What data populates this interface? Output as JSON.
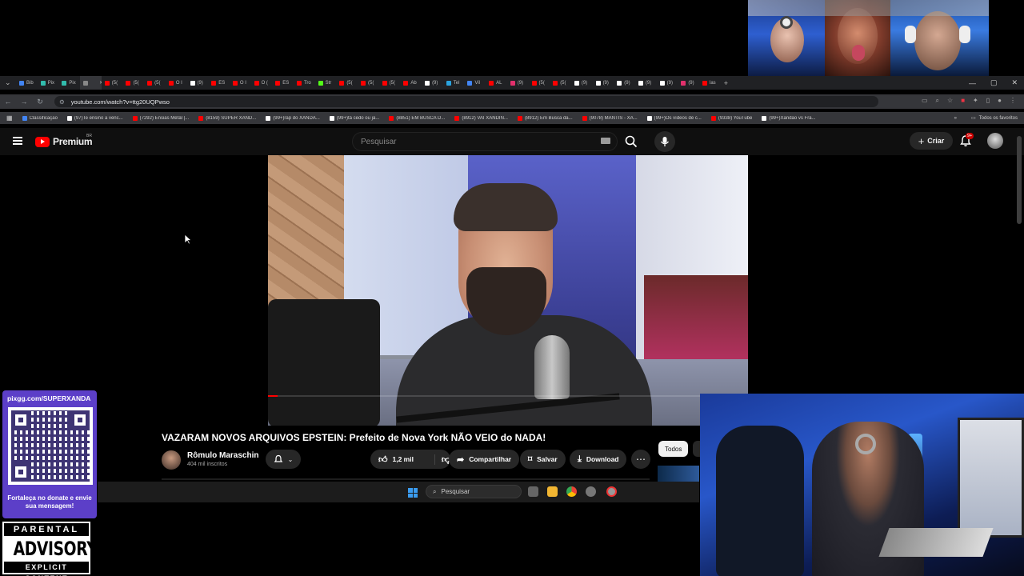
{
  "browser": {
    "url": "youtube.com/watch?v=ttg20UQPwso",
    "tabs": [
      {
        "label": "Bib",
        "color": "#4285f4"
      },
      {
        "label": "Pix",
        "color": "#32bcad"
      },
      {
        "label": "Pix",
        "color": "#32bcad"
      },
      {
        "label": "",
        "color": "#888888"
      },
      {
        "label": "(5(",
        "color": "#ff0000"
      },
      {
        "label": "(5(",
        "color": "#ff0000"
      },
      {
        "label": "(5(",
        "color": "#ff0000"
      },
      {
        "label": "O I",
        "color": "#ff0000"
      },
      {
        "label": "(9)",
        "color": "#ffffff"
      },
      {
        "label": "ES",
        "color": "#ff0000"
      },
      {
        "label": "O I",
        "color": "#ff0000"
      },
      {
        "label": "O (",
        "color": "#ff0000"
      },
      {
        "label": "ES",
        "color": "#ff0000"
      },
      {
        "label": "Tro",
        "color": "#ff0000"
      },
      {
        "label": "Str",
        "color": "#53fc18"
      },
      {
        "label": "(5(",
        "color": "#ff0000"
      },
      {
        "label": "(5(",
        "color": "#ff0000"
      },
      {
        "label": "(5(",
        "color": "#ff0000"
      },
      {
        "label": "Ab",
        "color": "#ff0000"
      },
      {
        "label": "(9)",
        "color": "#ffffff"
      },
      {
        "label": "Tel",
        "color": "#2aa3df"
      },
      {
        "label": "Vil",
        "color": "#4285f4"
      },
      {
        "label": "AL",
        "color": "#ff0000"
      },
      {
        "label": "(9)",
        "color": "#e1306c"
      },
      {
        "label": "(5(",
        "color": "#ff0000"
      },
      {
        "label": "(5(",
        "color": "#ff0000"
      },
      {
        "label": "(9)",
        "color": "#ffffff"
      },
      {
        "label": "(9)",
        "color": "#ffffff"
      },
      {
        "label": "(9)",
        "color": "#ffffff"
      },
      {
        "label": "(9)",
        "color": "#ffffff"
      },
      {
        "label": "(9)",
        "color": "#ffffff"
      },
      {
        "label": "(9)",
        "color": "#e1306c"
      },
      {
        "label": "las",
        "color": "#ff0000"
      }
    ],
    "bookmarks": [
      {
        "label": "Classificação",
        "color": "#4285f4"
      },
      {
        "label": "(97)Te ensino a venc...",
        "color": "#ffffff"
      },
      {
        "label": "(7292) Ensias Metal |...",
        "color": "#ff0000"
      },
      {
        "label": "(8159) SUPER XAND...",
        "color": "#ff0000"
      },
      {
        "label": "(99+)rap do XANDÃ...",
        "color": "#ffffff"
      },
      {
        "label": "(99+)tá cedo ou já...",
        "color": "#ffffff"
      },
      {
        "label": "(8851) EM BUSCA D...",
        "color": "#ff0000"
      },
      {
        "label": "(8912) VAI XANDIN...",
        "color": "#ff0000"
      },
      {
        "label": "(8912) Em Busca da...",
        "color": "#ff0000"
      },
      {
        "label": "(9078) MANTIS - XA...",
        "color": "#ff0000"
      },
      {
        "label": "(99+)Os vídeos de c...",
        "color": "#ffffff"
      },
      {
        "label": "(9338) YouTube",
        "color": "#ff0000"
      },
      {
        "label": "(99+)Xandão vs Fra...",
        "color": "#ffffff"
      }
    ],
    "all_bookmarks_label": "Todos os favoritos"
  },
  "youtube": {
    "logo_text": "Premium",
    "logo_region": "BR",
    "search_placeholder": "Pesquisar",
    "create_label": "Criar",
    "notif_badge": "9+",
    "video": {
      "title": "VAZARAM NOVOS ARQUIVOS EPSTEIN: Prefeito de Nova York NÃO VEIO do NADA!",
      "channel": "Rômulo Maraschin",
      "subscribers": "404 mil inscritos",
      "likes": "1,2 mil",
      "share_label": "Compartilhar",
      "save_label": "Salvar",
      "download_label": "Download",
      "progress": 0.02
    },
    "filter_chip": "Todos"
  },
  "taskbar": {
    "search_placeholder": "Pesquisar"
  },
  "overlay": {
    "qr_url": "pixgg.com/SUPERXANDA",
    "qr_message": "Fortaleça no donate e envie sua mensagem!",
    "advisory_top": "PARENTAL",
    "advisory_mid": "ADVISORY",
    "advisory_bottom": "EXPLICIT CONTENT"
  }
}
